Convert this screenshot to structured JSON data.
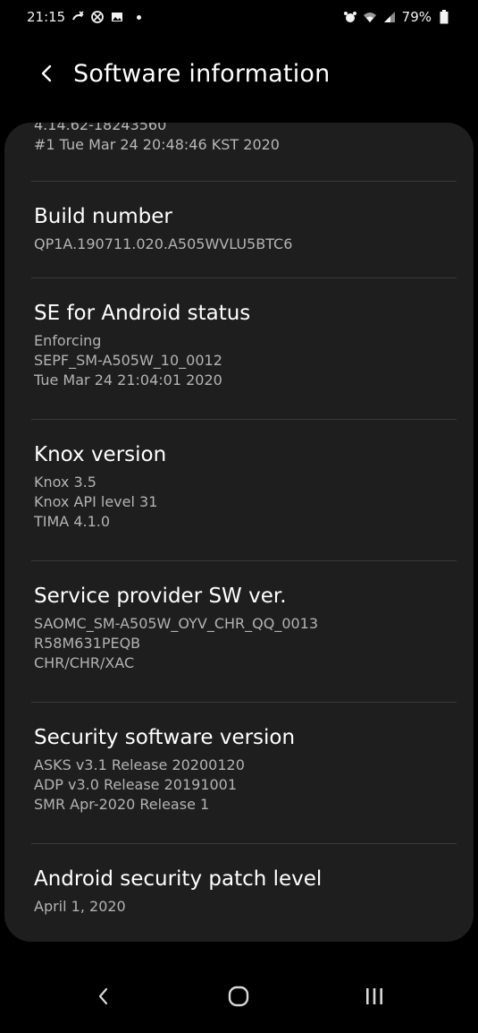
{
  "status_bar": {
    "time": "21:15",
    "battery": "79%"
  },
  "header": {
    "title": "Software information"
  },
  "partial_item": {
    "lines": [
      "4.14.62-18243560",
      "#1 Tue Mar 24 20:48:46 KST 2020"
    ]
  },
  "items": [
    {
      "title": "Build number",
      "lines": [
        "QP1A.190711.020.A505WVLU5BTC6"
      ]
    },
    {
      "title": "SE for Android status",
      "lines": [
        "Enforcing",
        "SEPF_SM-A505W_10_0012",
        "Tue Mar 24 21:04:01 2020"
      ]
    },
    {
      "title": "Knox version",
      "lines": [
        "Knox 3.5",
        "Knox API level 31",
        "TIMA 4.1.0"
      ]
    },
    {
      "title": "Service provider SW ver.",
      "lines": [
        "SAOMC_SM-A505W_OYV_CHR_QQ_0013",
        "R58M631PEQB",
        "CHR/CHR/XAC"
      ]
    },
    {
      "title": "Security software version",
      "lines": [
        "ASKS v3.1 Release 20200120",
        "ADP v3.0 Release 20191001",
        "SMR Apr-2020 Release 1"
      ]
    },
    {
      "title": "Android security patch level",
      "lines": [
        "April 1, 2020"
      ]
    }
  ],
  "colors": {
    "background": "#000000",
    "card": "#1e1e1e",
    "title_text": "#ffffff",
    "secondary_text": "#b3b3b3",
    "divider": "#3a3a3a"
  },
  "icons": {
    "status_left": [
      "missed-call-icon",
      "block-icon",
      "image-icon",
      "dot-icon"
    ],
    "status_right": [
      "alarm-icon",
      "wifi-icon",
      "signal-icon",
      "battery-icon"
    ],
    "header": "back-arrow-icon",
    "nav": [
      "back-icon",
      "home-icon",
      "recents-icon"
    ]
  }
}
